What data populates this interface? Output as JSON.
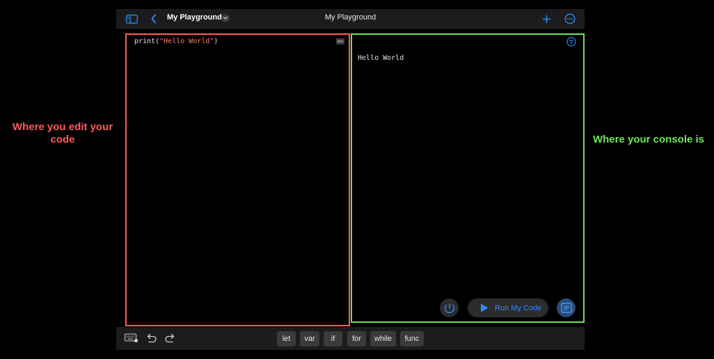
{
  "annotations": {
    "editor_label": "Where you edit your code",
    "console_label": "Where your console is"
  },
  "toolbar": {
    "document_name": "My Playground",
    "title": "My Playground"
  },
  "editor": {
    "code_prefix": "print(",
    "code_string": "\"Hello World\"",
    "code_suffix": ")",
    "abc_label": "abc"
  },
  "console": {
    "output": "Hello World",
    "run_button_label": "Run My Code"
  },
  "keyword_bar": {
    "keywords": [
      "let",
      "var",
      "if",
      "for",
      "while",
      "func"
    ]
  },
  "colors": {
    "accent": "#2f8cff",
    "editor_frame": "#ff5b5b",
    "console_frame": "#6ee55b",
    "string_literal": "#ff7e6b"
  },
  "icons": [
    "sidebar-icon",
    "back-chevron-icon",
    "chevron-down-icon",
    "plus-icon",
    "more-icon",
    "filter-icon",
    "speed-icon",
    "play-icon",
    "log-icon",
    "keyboard-icon",
    "undo-icon",
    "redo-icon"
  ]
}
